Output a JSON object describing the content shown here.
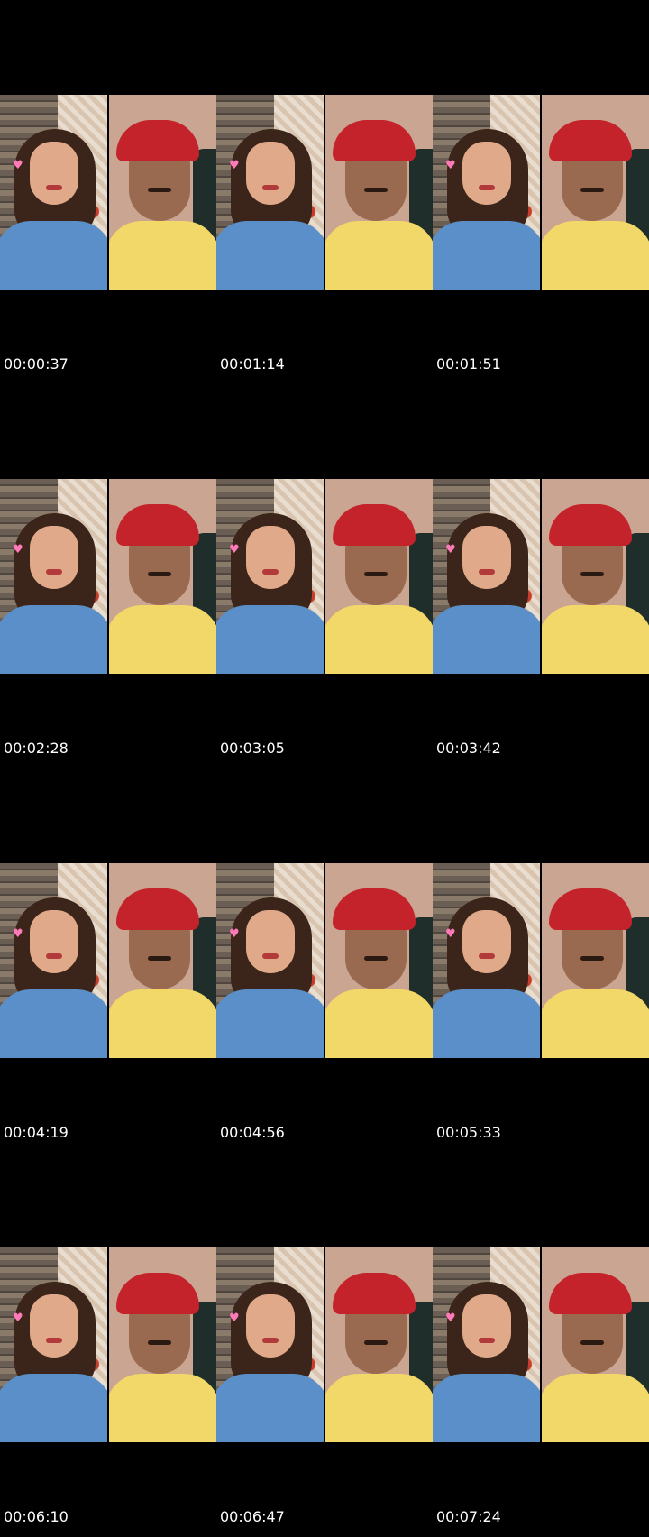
{
  "frames": [
    {
      "timestamp": "00:00:37"
    },
    {
      "timestamp": "00:01:14"
    },
    {
      "timestamp": "00:01:51"
    },
    {
      "timestamp": "00:02:28"
    },
    {
      "timestamp": "00:03:05"
    },
    {
      "timestamp": "00:03:42"
    },
    {
      "timestamp": "00:04:19"
    },
    {
      "timestamp": "00:04:56"
    },
    {
      "timestamp": "00:05:33"
    },
    {
      "timestamp": "00:06:10"
    },
    {
      "timestamp": "00:06:47"
    },
    {
      "timestamp": "00:07:24"
    }
  ],
  "colors": {
    "background": "#000000",
    "timestamp_text": "#ffffff"
  },
  "icons": {
    "frame_overlay": "heart-icon"
  }
}
